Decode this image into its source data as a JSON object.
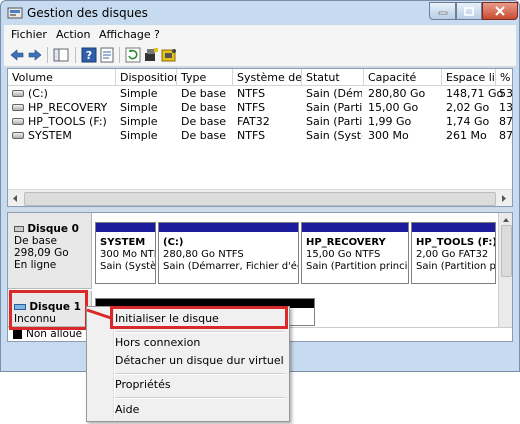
{
  "window": {
    "title": "Gestion des disques"
  },
  "menubar": {
    "items": [
      "Fichier",
      "Action",
      "Affichage",
      "?"
    ]
  },
  "volumes": {
    "headers": [
      "Volume",
      "Disposition",
      "Type",
      "Système de ...",
      "Statut",
      "Capacité",
      "Espace li...",
      "% L"
    ],
    "rows": [
      [
        "(C:)",
        "Simple",
        "De base",
        "NTFS",
        "Sain (Dém...",
        "280,80 Go",
        "148,71 Go",
        "53"
      ],
      [
        "HP_RECOVERY",
        "Simple",
        "De base",
        "NTFS",
        "Sain (Parti...",
        "15,00 Go",
        "2,02 Go",
        "13"
      ],
      [
        "HP_TOOLS (F:)",
        "Simple",
        "De base",
        "FAT32",
        "Sain (Parti...",
        "1,99 Go",
        "1,74 Go",
        "87"
      ],
      [
        "SYSTEM",
        "Simple",
        "De base",
        "NTFS",
        "Sain (Systè...",
        "300 Mo",
        "261 Mo",
        "87"
      ]
    ]
  },
  "disk0": {
    "name": "Disque 0",
    "type": "De base",
    "size": "298,09 Go",
    "status": "En ligne",
    "partitions": [
      {
        "name": "SYSTEM",
        "size": "300 Mo NTF",
        "status": "Sain (Systè"
      },
      {
        "name": "(C:)",
        "size": "280,80 Go NTFS",
        "status": "Sain (Démarrer, Fichier d'échar"
      },
      {
        "name": "HP_RECOVERY",
        "size": "15,00 Go NTFS",
        "status": "Sain (Partition principa"
      },
      {
        "name": "HP_TOOLS  (F:)",
        "size": "2,00 Go FAT32",
        "status": "Sain (Partition prin"
      }
    ]
  },
  "disk1": {
    "name": "Disque 1",
    "status": "Inconnu"
  },
  "legend": {
    "unallocated": "Non alloué"
  },
  "context_menu": {
    "items": [
      "Initialiser le disque",
      "Hors connexion",
      "Détacher un disque dur virtuel",
      "Propriétés",
      "Aide"
    ]
  },
  "colors": {
    "partition_bar": "#1c1c9c",
    "highlight_box": "#d9292a",
    "unallocated": "#000000"
  }
}
